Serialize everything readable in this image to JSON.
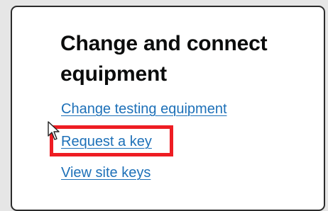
{
  "card": {
    "title": "Change and connect equipment",
    "links": [
      {
        "label": "Change testing equipment"
      },
      {
        "label": "Request a key"
      },
      {
        "label": "View site keys"
      }
    ]
  },
  "highlight": {
    "color": "#ee1d23",
    "target": "Request a key"
  },
  "cursor": {
    "icon": "mouse-pointer-icon"
  },
  "colors": {
    "link": "#1d70b8",
    "text": "#0b0c0c",
    "background": "#e6e6e6"
  }
}
